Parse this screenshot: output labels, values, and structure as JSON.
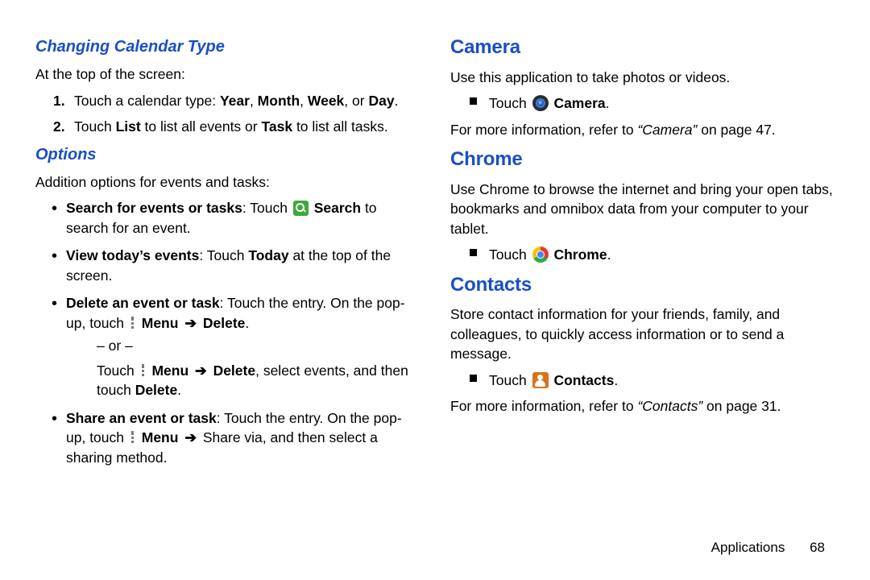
{
  "left": {
    "h1": "Changing Calendar Type",
    "intro": "At the top of the screen:",
    "step1_a": "Touch a calendar type: ",
    "step1_b": "Year",
    "step1_c": ", ",
    "step1_d": "Month",
    "step1_e": ", ",
    "step1_f": "Week",
    "step1_g": ", or ",
    "step1_h": "Day",
    "step1_i": ".",
    "step2_a": "Touch ",
    "step2_b": "List",
    "step2_c": " to list all events or ",
    "step2_d": "Task",
    "step2_e": " to list all tasks.",
    "h2": "Options",
    "opt_intro": "Addition options for events and tasks:",
    "b1_a": "Search for events or tasks",
    "b1_b": ": Touch ",
    "b1_c": "Search",
    "b1_d": " to search for an event.",
    "b2_a": "View today’s events",
    "b2_b": ": Touch ",
    "b2_c": "Today",
    "b2_d": " at the top of the screen.",
    "b3_a": "Delete an event or task",
    "b3_b": ": Touch the entry. On the pop-up, touch ",
    "b3_c": "Menu",
    "b3_d": "Delete",
    "b3_e": ".",
    "or": "– or –",
    "b3f_a": "Touch ",
    "b3f_b": "Menu",
    "b3f_c": "Delete",
    "b3f_d": ", select events, and then touch ",
    "b3f_e": "Delete",
    "b3f_f": ".",
    "b4_a": "Share an event or task",
    "b4_b": ": Touch the entry. On the pop-up, touch ",
    "b4_c": "Menu",
    "b4_d": " Share via, and then select a sharing method."
  },
  "right": {
    "camera_h": "Camera",
    "camera_p": "Use this application to take photos or videos.",
    "camera_t1": "Touch ",
    "camera_t2": "Camera",
    "camera_t3": ".",
    "camera_ref_a": "For more information, refer to ",
    "camera_ref_b": "“Camera”",
    "camera_ref_c": " on page 47.",
    "chrome_h": "Chrome",
    "chrome_p": "Use Chrome to browse the internet and bring your open tabs, bookmarks and omnibox data from your computer to your tablet.",
    "chrome_t1": "Touch ",
    "chrome_t2": "Chrome",
    "chrome_t3": ".",
    "contacts_h": "Contacts",
    "contacts_p": "Store contact information for your friends, family, and colleagues, to quickly access information or to send a message.",
    "contacts_t1": "Touch ",
    "contacts_t2": "Contacts",
    "contacts_t3": ".",
    "contacts_ref_a": "For more information, refer to ",
    "contacts_ref_b": "“Contacts”",
    "contacts_ref_c": " on page 31."
  },
  "footer": {
    "section": "Applications",
    "page": "68"
  },
  "glyphs": {
    "arrow": "➔"
  }
}
